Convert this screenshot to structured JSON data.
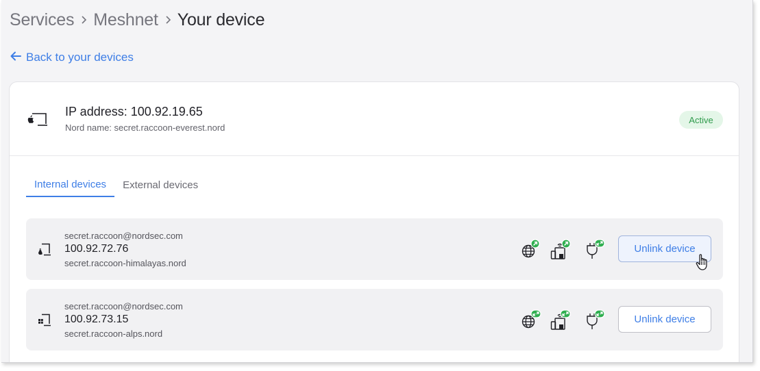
{
  "breadcrumb": {
    "items": [
      "Services",
      "Meshnet",
      "Your device"
    ]
  },
  "back_link": {
    "label": "Back to your devices"
  },
  "device": {
    "ip_title": "IP address: 100.92.19.65",
    "nord_name": "Nord name: secret.raccoon-everest.nord",
    "status": "Active",
    "icon": "macbook-icon"
  },
  "tabs": [
    {
      "label": "Internal devices",
      "active": true
    },
    {
      "label": "External devices",
      "active": false
    }
  ],
  "devices": [
    {
      "email": "secret.raccoon@nordsec.com",
      "ip": "100.92.72.76",
      "name": "secret.raccoon-himalayas.nord",
      "icon": "linux-laptop-icon",
      "permissions": [
        "routing-icon",
        "lan-access-icon",
        "incoming-connection-icon"
      ],
      "button": "Unlink device"
    },
    {
      "email": "secret.raccoon@nordsec.com",
      "ip": "100.92.73.15",
      "name": "secret.raccoon-alps.nord",
      "icon": "windows-laptop-icon",
      "permissions": [
        "routing-icon",
        "lan-access-icon",
        "incoming-connection-icon"
      ],
      "button": "Unlink device"
    }
  ],
  "colors": {
    "accent": "#3e7ee6",
    "badge_bg": "#e4f6e8",
    "badge_text": "#2f9a4c",
    "permission_badge": "#2fae4f"
  }
}
